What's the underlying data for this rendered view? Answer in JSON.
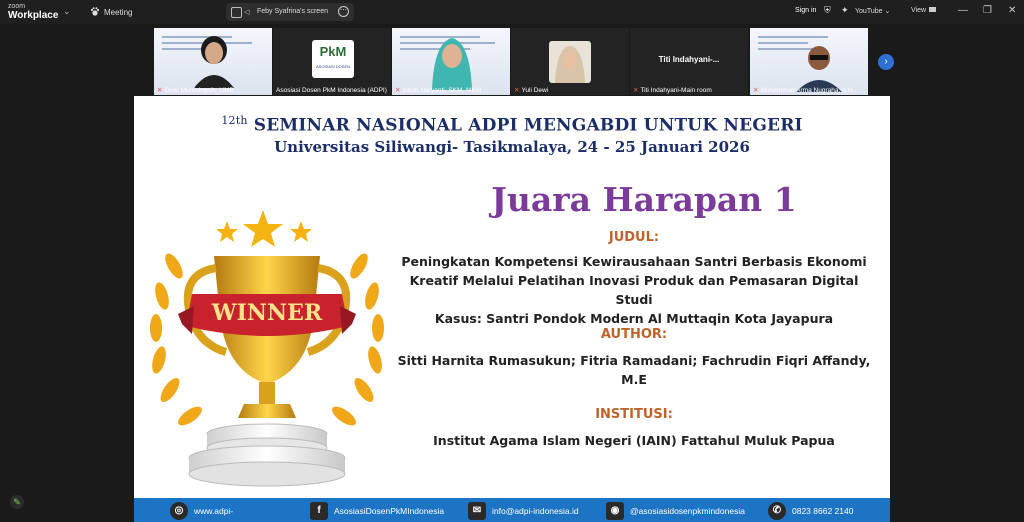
{
  "app": {
    "brand_top": "zoom",
    "brand_main": "Workplace",
    "meeting_tab": "Meeting"
  },
  "share": {
    "label": "Feby Syafrina's screen"
  },
  "topbar": {
    "signin": "Sign in",
    "youtube": "YouTube",
    "view": "View"
  },
  "participants": [
    {
      "name": "Dewi Murtiningsih_UMB",
      "muted": true
    },
    {
      "name": "Asosiasi Dosen PkM Indonesia (ADPI)",
      "muted": false,
      "logo_text": "PkM",
      "logo_sub": "ASOSIASI DOSEN"
    },
    {
      "name": "Indah Naryanti, SKM, MKM",
      "muted": true
    },
    {
      "name": "Yuli Dewi",
      "muted": true
    },
    {
      "name": "Titi Indahyani-Main room",
      "muted": true,
      "center_text": "Titi Indahyani-..."
    },
    {
      "name": "Muhammad Arma Nugraha, A.N...",
      "muted": true
    }
  ],
  "slide": {
    "seminar_num": "12th",
    "seminar_title": "SEMINAR NASIONAL ADPI MENGABDI UNTUK NEGERI",
    "university": "Universitas Siliwangi- Tasikmalaya, 24 - 25 Januari 2026",
    "award": "Juara Harapan 1",
    "judul_label": "JUDUL:",
    "judul_lines": [
      "Peningkatan Kompetensi Kewirausahaan Santri Berbasis Ekonomi",
      "Kreatif Melalui Pelatihan Inovasi Produk dan Pemasaran Digital Studi",
      "Kasus: Santri Pondok Modern Al Muttaqin Kota Jayapura"
    ],
    "author_label": "AUTHOR:",
    "author_lines": [
      "Sitti Harnita Rumasukun; Fitria Ramadani; Fachrudin Fiqri Affandy,",
      "M.E"
    ],
    "institusi_label": "INSTITUSI:",
    "institusi": "Institut Agama Islam Negeri (IAIN) Fattahul Muluk Papua",
    "trophy_banner": "WINNER",
    "footer": {
      "web": "www.adpi-",
      "facebook": "AsosiasiDosenPkMIndonesia",
      "email": "info@adpi-indonesia.id",
      "instagram": "@asosiasidosenpkmindonesia",
      "phone": "0823 8662 2140"
    }
  },
  "colors": {
    "title_navy": "#1c2d6a",
    "award_purple": "#7c3a9b",
    "label_orange": "#c0632a",
    "footer_blue": "#1e74c4",
    "active_green": "#8fd14f"
  }
}
